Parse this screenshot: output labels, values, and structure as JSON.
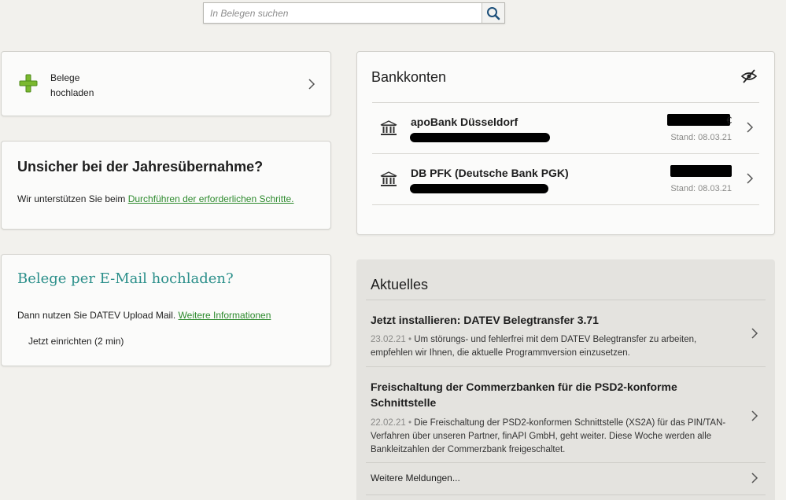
{
  "search": {
    "placeholder": "In Belegen suchen",
    "icon": "search-icon"
  },
  "upload": {
    "label_line1": "Belege",
    "label_line2": "hochladen",
    "icon": "plus-icon",
    "accent": "#7ab82e"
  },
  "year_takeover": {
    "title": "Unsicher bei der Jahresübernahme?",
    "text": "Wir unterstützen Sie beim ",
    "link": "Durchführen der erforderlichen Schritte."
  },
  "email_upload": {
    "title": "Belege per E-Mail hochladen?",
    "text": "Dann nutzen Sie DATEV Upload Mail. ",
    "link": "Weitere Informationen",
    "setup_label": "Jetzt einrichten (2 min)",
    "title_color": "#2b8f8a"
  },
  "bank_accounts": {
    "title": "Bankkonten",
    "accounts": [
      {
        "name": "apoBank Düsseldorf",
        "stand": "Stand: 08.03.21",
        "amount_suffix": "€"
      },
      {
        "name": "DB PFK (Deutsche Bank PGK)",
        "stand": "Stand: 08.03.21",
        "amount_suffix": ""
      }
    ]
  },
  "news": {
    "title": "Aktuelles",
    "items": [
      {
        "title": "Jetzt installieren: DATEV Belegtransfer 3.71",
        "date": "23.02.21",
        "separator": " • ",
        "body": "Um störungs- und fehlerfrei mit dem DATEV Belegtransfer zu arbeiten, empfehlen wir Ihnen, die aktuelle Programmversion einzusetzen."
      },
      {
        "title": "Freischaltung der Commerzbanken für die PSD2-konforme Schnittstelle",
        "date": "22.02.21",
        "separator": " • ",
        "body": "Die Freischaltung der PSD2-konformen Schnittstelle (XS2A) für das PIN/TAN-Verfahren über unseren Partner, finAPI GmbH, geht weiter. Diese Woche werden alle Bankleitzahlen der Commerzbank freigeschaltet."
      }
    ],
    "more_label": "Weitere Meldungen..."
  },
  "colors": {
    "link": "#2d8a2d",
    "background": "#f2f1ed"
  }
}
